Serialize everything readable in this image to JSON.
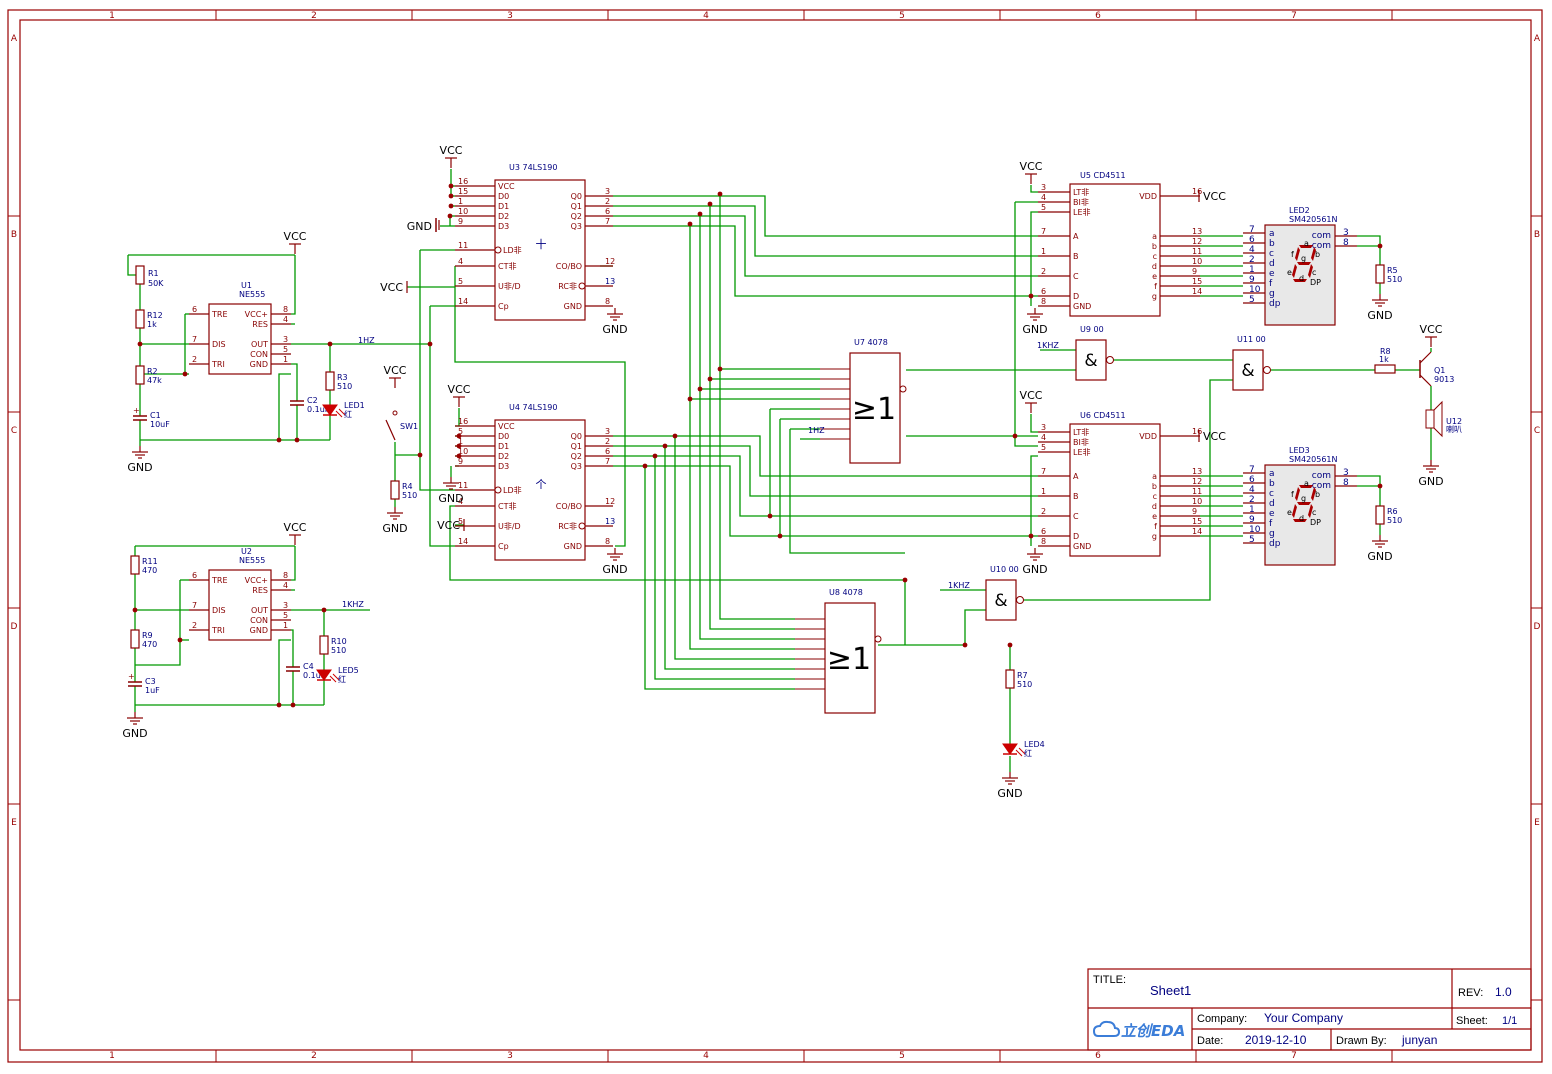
{
  "colors": {
    "frame": "#990000",
    "wire": "#009900",
    "body": "#880000",
    "label": "#000080",
    "netlabel": "#000080",
    "chip_fill": "#ffffff",
    "display_fill": "#e8e8e8",
    "led_fill": "#cc0000",
    "title_text": "#000080"
  },
  "border": {
    "columns": [
      "1",
      "2",
      "3",
      "4",
      "5",
      "6",
      "7"
    ],
    "rows": [
      "A",
      "B",
      "C",
      "D",
      "E"
    ]
  },
  "power": {
    "vcc": "VCC",
    "gnd": "GND"
  },
  "nets": {
    "hz1": "1HZ",
    "khz1": "1KHZ",
    "khz1_alt": "1KHZ"
  },
  "u1": {
    "ref": "U1",
    "part": "NE555",
    "pins_left": [
      "TRE",
      "DIS",
      "TRI"
    ],
    "pins_left_no": [
      "6",
      "7",
      "2"
    ],
    "pins_right": [
      "VCC+",
      "RES",
      "OUT",
      "CON",
      "GND"
    ],
    "pins_right_no": [
      "8",
      "4",
      "3",
      "5",
      "1"
    ]
  },
  "u2": {
    "ref": "U2",
    "part": "NE555",
    "pins_left": [
      "TRE",
      "DIS",
      "TRI"
    ],
    "pins_left_no": [
      "6",
      "7",
      "2"
    ],
    "pins_right": [
      "VCC+",
      "RES",
      "OUT",
      "CON",
      "GND"
    ],
    "pins_right_no": [
      "8",
      "4",
      "3",
      "5",
      "1"
    ]
  },
  "u3": {
    "ref": "U3",
    "part": "74LS190",
    "mark": "十",
    "pins_left": [
      "VCC",
      "D0",
      "D1",
      "D2",
      "D3",
      "LD非",
      "CT非",
      "U非/D",
      "Cp"
    ],
    "pins_left_no": [
      "16",
      "15",
      "1",
      "10",
      "9",
      "11",
      "4",
      "5",
      "14"
    ],
    "pins_right": [
      "Q0",
      "Q1",
      "Q2",
      "Q3",
      "CO/BO",
      "RC非",
      "GND"
    ],
    "pins_right_no": [
      "3",
      "2",
      "6",
      "7",
      "12",
      "13",
      "8"
    ]
  },
  "u4": {
    "ref": "U4",
    "part": "74LS190",
    "mark": "个",
    "pins_left": [
      "VCC",
      "D0",
      "D1",
      "D2",
      "D3",
      "LD非",
      "CT非",
      "U非/D",
      "Cp"
    ],
    "pins_left_no": [
      "16",
      "5",
      "1",
      "10",
      "9",
      "11",
      "4",
      "5",
      "14"
    ],
    "pins_right": [
      "Q0",
      "Q1",
      "Q2",
      "Q3",
      "CO/BO",
      "RC非",
      "GND"
    ],
    "pins_right_no": [
      "3",
      "2",
      "6",
      "7",
      "12",
      "13",
      "8"
    ]
  },
  "u5": {
    "ref": "U5",
    "part": "CD4511",
    "pins_left": [
      "LT非",
      "BI非",
      "LE非",
      "A",
      "B",
      "C",
      "D",
      "GND"
    ],
    "pins_left_no": [
      "3",
      "4",
      "5",
      "7",
      "1",
      "2",
      "6",
      "8"
    ],
    "pins_right": [
      "VDD",
      "a",
      "b",
      "c",
      "d",
      "e",
      "f",
      "g"
    ],
    "pins_right_no": [
      "16",
      "13",
      "12",
      "11",
      "10",
      "9",
      "15",
      "14"
    ]
  },
  "u6": {
    "ref": "U6",
    "part": "CD4511",
    "pins_left": [
      "LT非",
      "BI非",
      "LE非",
      "A",
      "B",
      "C",
      "D",
      "GND"
    ],
    "pins_left_no": [
      "3",
      "4",
      "5",
      "7",
      "1",
      "2",
      "6",
      "8"
    ],
    "pins_right": [
      "VDD",
      "a",
      "b",
      "c",
      "d",
      "e",
      "f",
      "g"
    ],
    "pins_right_no": [
      "16",
      "13",
      "12",
      "11",
      "10",
      "9",
      "15",
      "14"
    ]
  },
  "u7": {
    "ref": "U7",
    "part": "4078",
    "symbol": "≥1"
  },
  "u8": {
    "ref": "U8",
    "part": "4078",
    "symbol": "≥1"
  },
  "u9": {
    "ref": "U9",
    "part": "00",
    "symbol": "&"
  },
  "u10": {
    "ref": "U10",
    "part": "00",
    "symbol": "&"
  },
  "u11": {
    "ref": "U11",
    "part": "00",
    "symbol": "&"
  },
  "led2": {
    "ref": "LED2",
    "part": "SM420561N",
    "segs": [
      "a",
      "b",
      "c",
      "d",
      "e",
      "f",
      "g",
      "dp"
    ],
    "seg_no": [
      "7",
      "6",
      "4",
      "2",
      "1",
      "9",
      "10",
      "5"
    ],
    "com": [
      "com",
      "com"
    ],
    "com_no": [
      "3",
      "8"
    ],
    "glyph": [
      "a",
      "f",
      "g",
      "b",
      "e",
      "c",
      "d",
      "DP"
    ]
  },
  "led3": {
    "ref": "LED3",
    "part": "SM420561N",
    "segs": [
      "a",
      "b",
      "c",
      "d",
      "e",
      "f",
      "g",
      "dp"
    ],
    "seg_no": [
      "7",
      "6",
      "4",
      "2",
      "1",
      "9",
      "10",
      "5"
    ],
    "com": [
      "com",
      "com"
    ],
    "com_no": [
      "3",
      "8"
    ],
    "glyph": [
      "a",
      "f",
      "g",
      "b",
      "e",
      "c",
      "d",
      "DP"
    ]
  },
  "passives": {
    "r1": [
      "R1",
      "50K"
    ],
    "r12": [
      "R12",
      "1k"
    ],
    "r2": [
      "R2",
      "47k"
    ],
    "c1": [
      "C1",
      "10uF"
    ],
    "c2": [
      "C2",
      "0.1uF"
    ],
    "r3": [
      "R3",
      "510"
    ],
    "led1": [
      "LED1",
      "红"
    ],
    "r11": [
      "R11",
      "470"
    ],
    "r9": [
      "R9",
      "470"
    ],
    "c3": [
      "C3",
      "1uF"
    ],
    "c4": [
      "C4",
      "0.1uF"
    ],
    "r10": [
      "R10",
      "510"
    ],
    "led5": [
      "LED5",
      "红"
    ],
    "sw1": [
      "SW1"
    ],
    "r4": [
      "R4",
      "510"
    ],
    "r5": [
      "R5",
      "510"
    ],
    "r6": [
      "R6",
      "510"
    ],
    "r7": [
      "R7",
      "510"
    ],
    "led4": [
      "LED4",
      "红"
    ],
    "r8": [
      "R8",
      "1k"
    ],
    "q1": [
      "Q1",
      "9013"
    ],
    "u12": [
      "U12",
      "喇叭"
    ]
  },
  "title_block": {
    "title_label": "TITLE:",
    "title": "Sheet1",
    "rev_label": "REV:",
    "rev": "1.0",
    "company_label": "Company:",
    "company": "Your Company",
    "sheet_label": "Sheet:",
    "sheet": "1/1",
    "date_label": "Date:",
    "date": "2019-12-10",
    "drawn_label": "Drawn By:",
    "drawn": "junyan",
    "logo": "立创EDA"
  }
}
